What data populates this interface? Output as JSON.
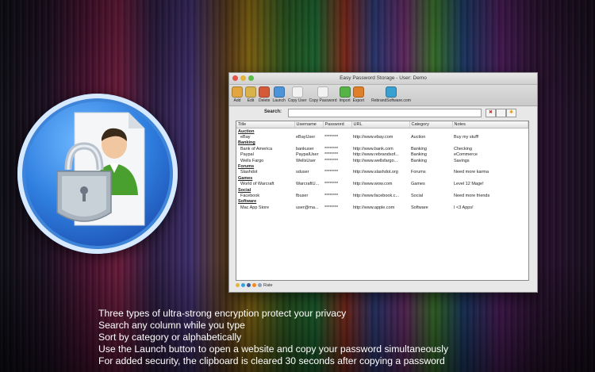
{
  "window": {
    "title": "Easy Password Storage - User: Demo",
    "toolbar": [
      {
        "label": "Add",
        "icon": "add-user-icon",
        "color": "#e2a640"
      },
      {
        "label": "Edit",
        "icon": "edit-user-icon",
        "color": "#d9b24a"
      },
      {
        "label": "Delete",
        "icon": "delete-user-icon",
        "color": "#d45a3a"
      },
      {
        "label": "Launch",
        "icon": "launch-icon",
        "color": "#4c93d8"
      },
      {
        "label": "Copy User",
        "icon": "copy-user-icon",
        "color": "#f2f2f2"
      },
      {
        "label": "Copy Password",
        "icon": "copy-password-icon",
        "color": "#f2f2f2"
      },
      {
        "label": "Import",
        "icon": "import-icon",
        "color": "#57b348"
      },
      {
        "label": "Export",
        "icon": "export-icon",
        "color": "#e07f2a"
      },
      {
        "label": "RebrandSoftware.com",
        "icon": "globe-icon",
        "color": "#3aa0d0"
      }
    ],
    "search": {
      "label": "Search:",
      "value": ""
    },
    "columns": [
      "Title",
      "Username",
      "Password",
      "URL",
      "Category",
      "Notes"
    ],
    "rows": [
      {
        "type": "category",
        "title": "Auction"
      },
      {
        "type": "entry",
        "title": "eBay",
        "username": "eBayUser",
        "password": "********",
        "url": "http://www.ebay.com",
        "category": "Auction",
        "notes": "Buy my stuff!"
      },
      {
        "type": "category",
        "title": "Banking"
      },
      {
        "type": "entry",
        "title": "Bank of America",
        "username": "bankuser",
        "password": "********",
        "url": "http://www.bank.com",
        "category": "Banking",
        "notes": "Checking"
      },
      {
        "type": "entry",
        "title": "Paypal",
        "username": "PaypalUser",
        "password": "********",
        "url": "http://www.rebrandsof...",
        "category": "Banking",
        "notes": "eCommerce"
      },
      {
        "type": "entry",
        "title": "Wells Fargo",
        "username": "WellsUser",
        "password": "********",
        "url": "http://www.wellsfargo...",
        "category": "Banking",
        "notes": "Savings"
      },
      {
        "type": "category",
        "title": "Forums"
      },
      {
        "type": "entry",
        "title": "Slashdot",
        "username": "sduser",
        "password": "********",
        "url": "http://www.slashdot.org",
        "category": "Forums",
        "notes": "Need more karma"
      },
      {
        "type": "category",
        "title": "Games"
      },
      {
        "type": "entry",
        "title": "World of Warcraft",
        "username": "WarcraftU...",
        "password": "********",
        "url": "http://www.wow.com",
        "category": "Games",
        "notes": "Level 12 Mage!"
      },
      {
        "type": "category",
        "title": "Social"
      },
      {
        "type": "entry",
        "title": "Facebook",
        "username": "fbuser",
        "password": "********",
        "url": "http://www.facebook.c...",
        "category": "Social",
        "notes": "Need more friends"
      },
      {
        "type": "category",
        "title": "Software"
      },
      {
        "type": "entry",
        "title": "Mac App Store",
        "username": "user@ma...",
        "password": "********",
        "url": "http://www.apple.com",
        "category": "Software",
        "notes": "I <3 Apps!"
      }
    ],
    "status": {
      "rate_label": "Rate"
    }
  },
  "captions": [
    "Three types of ultra-strong encryption protect your privacy",
    "Search any column while you type",
    "Sort by category or alphabetically",
    "Use the Launch button to open a website and copy your password simultaneously",
    "For added security, the clipboard is cleared 30 seconds after copying a password"
  ]
}
